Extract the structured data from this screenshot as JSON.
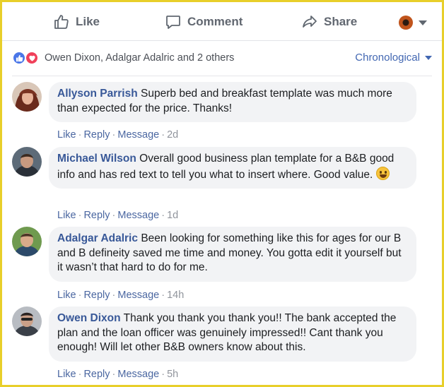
{
  "action_bar": {
    "like_label": "Like",
    "comment_label": "Comment",
    "share_label": "Share"
  },
  "reactions": {
    "names": "Owen Dixon, Adalgar Adalric and 2 others",
    "types": [
      "like",
      "love"
    ]
  },
  "sort": {
    "label": "Chronological"
  },
  "colors": {
    "link": "#4267b2",
    "name": "#385898",
    "bubble": "#f2f3f5",
    "frame": "#e8cf2a"
  },
  "comments": [
    {
      "author": "Allyson Parrish",
      "text": "Superb bed and breakfast template was much more than expected for the price. Thanks!",
      "has_emoji": false,
      "actions": {
        "like": "Like",
        "reply": "Reply",
        "message": "Message",
        "time": "2d"
      }
    },
    {
      "author": "Michael Wilson",
      "text": "Overall good business plan template for a B&B good info and has red text to tell you what to insert where. Good value.",
      "has_emoji": true,
      "actions": {
        "like": "Like",
        "reply": "Reply",
        "message": "Message",
        "time": "1d"
      }
    },
    {
      "author": "Adalgar Adalric",
      "text": "Been looking for something like this for ages for our B and B defineity saved me time and money. You gotta edit it yourself but it wasn’t that hard to do for me.",
      "has_emoji": false,
      "actions": {
        "like": "Like",
        "reply": "Reply",
        "message": "Message",
        "time": "14h"
      }
    },
    {
      "author": "Owen Dixon",
      "text": "Thank you thank you thank you!! The bank accepted the plan and the loan officer was genuinely impressed!! Cant thank you enough! Will let other B&B owners know about this.",
      "has_emoji": false,
      "actions": {
        "like": "Like",
        "reply": "Reply",
        "message": "Message",
        "time": "5h"
      }
    }
  ]
}
